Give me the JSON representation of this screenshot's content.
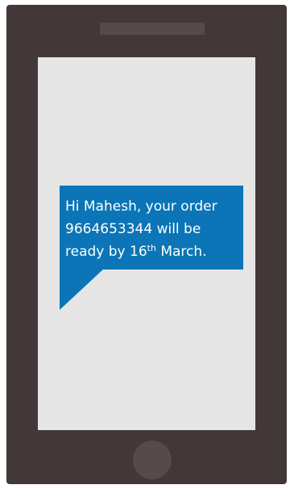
{
  "message": {
    "line1": "Hi Mahesh, your order",
    "line2": "9664653344 will be",
    "line3_before": "ready by 16",
    "line3_sup": "th",
    "line3_after": " March.",
    "bubble_color": "#0b75b7"
  },
  "device": {
    "body_color": "#433838",
    "screen_color": "#e6e6e6"
  }
}
